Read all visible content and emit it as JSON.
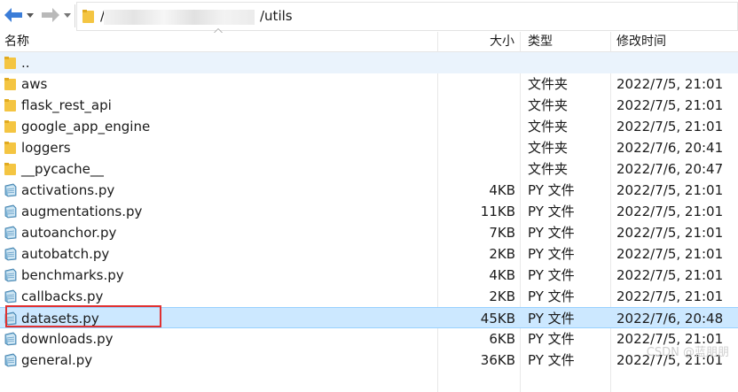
{
  "toolbar": {
    "path_prefix": "/",
    "path_suffix": "/utils"
  },
  "columns": {
    "name": "名称",
    "size": "大小",
    "type": "类型",
    "modified": "修改时间"
  },
  "parent_row": {
    "name": ".."
  },
  "rows": [
    {
      "name": "aws",
      "size": "",
      "type": "文件夹",
      "modified": "2022/7/5, 21:01",
      "kind": "folder"
    },
    {
      "name": "flask_rest_api",
      "size": "",
      "type": "文件夹",
      "modified": "2022/7/5, 21:01",
      "kind": "folder"
    },
    {
      "name": "google_app_engine",
      "size": "",
      "type": "文件夹",
      "modified": "2022/7/5, 21:01",
      "kind": "folder"
    },
    {
      "name": "loggers",
      "size": "",
      "type": "文件夹",
      "modified": "2022/7/6, 20:41",
      "kind": "folder"
    },
    {
      "name": "__pycache__",
      "size": "",
      "type": "文件夹",
      "modified": "2022/7/6, 20:47",
      "kind": "folder"
    },
    {
      "name": "activations.py",
      "size": "4KB",
      "type": "PY 文件",
      "modified": "2022/7/5, 21:01",
      "kind": "file"
    },
    {
      "name": "augmentations.py",
      "size": "11KB",
      "type": "PY 文件",
      "modified": "2022/7/5, 21:01",
      "kind": "file"
    },
    {
      "name": "autoanchor.py",
      "size": "7KB",
      "type": "PY 文件",
      "modified": "2022/7/5, 21:01",
      "kind": "file"
    },
    {
      "name": "autobatch.py",
      "size": "2KB",
      "type": "PY 文件",
      "modified": "2022/7/5, 21:01",
      "kind": "file"
    },
    {
      "name": "benchmarks.py",
      "size": "4KB",
      "type": "PY 文件",
      "modified": "2022/7/5, 21:01",
      "kind": "file"
    },
    {
      "name": "callbacks.py",
      "size": "2KB",
      "type": "PY 文件",
      "modified": "2022/7/5, 21:01",
      "kind": "file"
    },
    {
      "name": "datasets.py",
      "size": "45KB",
      "type": "PY 文件",
      "modified": "2022/7/6, 20:48",
      "kind": "file",
      "selected": true
    },
    {
      "name": "downloads.py",
      "size": "6KB",
      "type": "PY 文件",
      "modified": "2022/7/5, 21:01",
      "kind": "file"
    },
    {
      "name": "general.py",
      "size": "36KB",
      "type": "PY 文件",
      "modified": "2022/7/5, 21:01",
      "kind": "file"
    }
  ],
  "watermark": "CSDN @蓝朋朋",
  "colors": {
    "selection": "#cce8ff",
    "highlight_box": "#e03131",
    "folder": "#f4c542",
    "nav_arrow": "#3b7dd8"
  },
  "icons": {
    "back": "arrow-left-icon",
    "forward": "arrow-right-icon",
    "folder": "folder-icon",
    "file": "python-file-icon"
  }
}
